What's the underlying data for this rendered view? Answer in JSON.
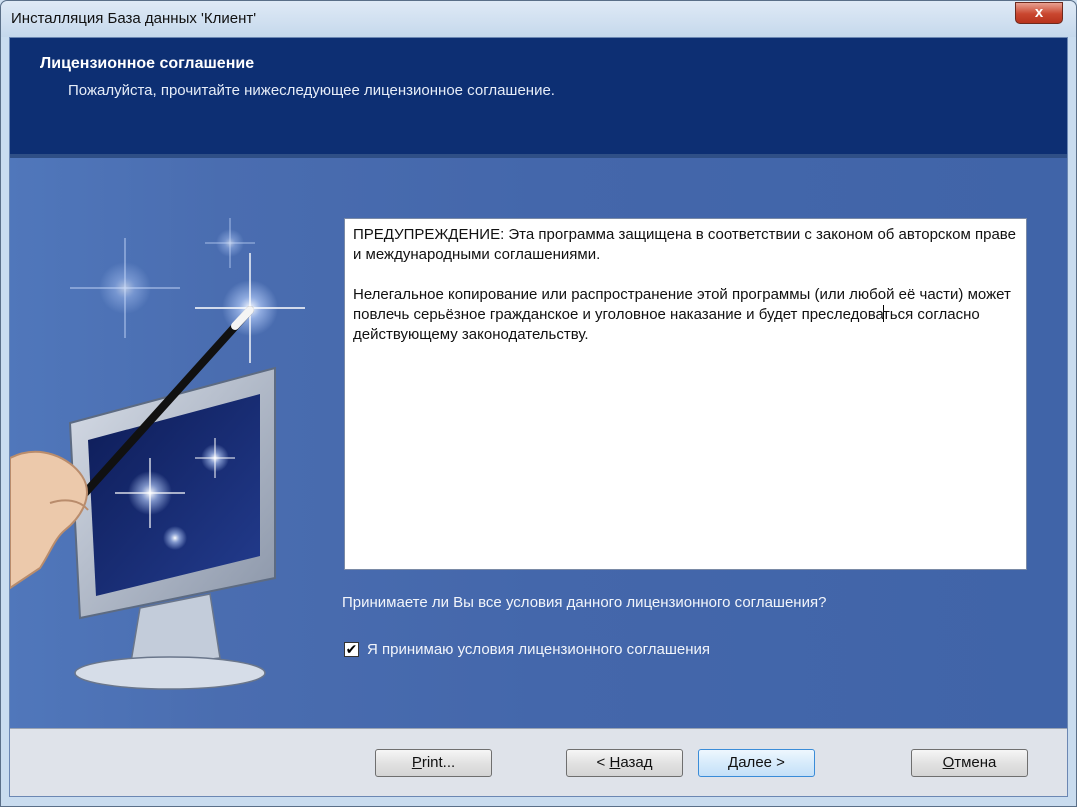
{
  "window": {
    "title": "Инсталляция База данных 'Клиент'",
    "close_glyph": "x"
  },
  "header": {
    "title": "Лицензионное соглашение",
    "subtitle": "Пожалуйста, прочитайте нижеследующее лицензионное соглашение."
  },
  "license": {
    "paragraph1": "ПРЕДУПРЕЖДЕНИЕ: Эта программа защищена в соответствии с законом об авторском праве и международными соглашениями.",
    "paragraph2_before_caret": "Нелегальное копирование или распространение этой программы (или любой её части) может повлечь серьёзное гражданское и уголовное наказание и будет преследова",
    "paragraph2_after_caret": "ться согласно действующему законодательству."
  },
  "question": "Принимаете ли Вы все условия данного лицензионного соглашения?",
  "accept": {
    "label": "Я принимаю условия лицензионного соглашения",
    "checked": true
  },
  "buttons": {
    "print": {
      "pre": "",
      "mnemonic": "P",
      "post": "rint..."
    },
    "back": {
      "pre": "< ",
      "mnemonic": "Н",
      "post": "азад"
    },
    "next": {
      "pre": "",
      "mnemonic": "Д",
      "post": "алее >"
    },
    "cancel": {
      "pre": "",
      "mnemonic": "О",
      "post": "тмена"
    }
  },
  "colors": {
    "header_bg": "#0d2f73",
    "body_bg": "#4467ab",
    "close_button": "#c9462f"
  },
  "icons": {
    "wizard_art": "magic-wand-monitor-icon",
    "close": "close-icon",
    "checkbox": "checkmark-icon"
  }
}
